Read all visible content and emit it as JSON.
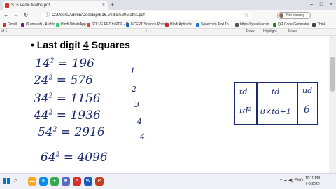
{
  "browser": {
    "tab_title": "S16.Vedic Maths.pdf",
    "tab_close": "×",
    "new_tab": "+",
    "window_controls": [
      "–",
      "□",
      "×"
    ],
    "address": "C:/Users/Admin/Desktop/S16.Vedic%20Maths.pdf",
    "address_info_label": "File",
    "profile_label": "Not syncing",
    "menu": "⋯"
  },
  "bookmarks": [
    {
      "label": "Gmail",
      "color": "#d93025"
    },
    {
      "label": "(9 unread) - Arabic...",
      "color": "#6a1b9a"
    },
    {
      "label": "Hindi WhatsApp",
      "color": "#25d366"
    },
    {
      "label": "SOLVE PPT to PDF - P...",
      "color": "#e64a19"
    },
    {
      "label": "NCERT Science Portal",
      "color": "#1565c0"
    },
    {
      "label": "Hindi Aptitude",
      "color": "#c62828"
    },
    {
      "label": "Speech to Text To...",
      "color": "#1976d2"
    },
    {
      "label": "https://greatlearnin...",
      "color": "#555555"
    },
    {
      "label": "QR Code Generator...",
      "color": "#2e7d32"
    },
    {
      "label": "Think",
      "color": "#444444"
    }
  ],
  "pdf_toolbar": {
    "page": "of 1",
    "zoom_out": "−",
    "zoom_in": "+",
    "draw": "Draw",
    "highlight": "Highlight",
    "erase": "Erase"
  },
  "document": {
    "bullet": "•",
    "heading_prefix": "Last digit",
    "heading_number": "4",
    "heading_suffix": "Squares",
    "equations": [
      {
        "base": "14",
        "result": "196"
      },
      {
        "base": "24",
        "result": "576"
      },
      {
        "base": "34",
        "result": "1156"
      },
      {
        "base": "44",
        "result": "1936"
      },
      {
        "base": "54",
        "result": "2916"
      },
      {
        "base": "64",
        "result": "4096"
      }
    ],
    "exponent": "2",
    "equals": "=",
    "side_digits": [
      "1",
      "2",
      "3",
      "4",
      "4"
    ],
    "box": {
      "top_left": "td",
      "top_mid": "td.",
      "top_right": "ud",
      "bottom_left": "td²",
      "bottom_mid": "8×td+1",
      "bottom_right": "6"
    }
  },
  "taskbar": {
    "search_icon": "⌕",
    "apps": [
      {
        "name": "file-explorer",
        "color": "#f9a825",
        "glyph": "▬"
      },
      {
        "name": "edge",
        "color": "#0c8ce9",
        "glyph": "e"
      },
      {
        "name": "chrome",
        "color": "#34a853",
        "glyph": "●"
      },
      {
        "name": "store",
        "color": "#5c6bc0",
        "glyph": "■"
      },
      {
        "name": "pdf",
        "color": "#d32f2f",
        "glyph": "A"
      },
      {
        "name": "word",
        "color": "#1e5bb8",
        "glyph": "W"
      },
      {
        "name": "powerpoint",
        "color": "#c43e1c",
        "glyph": "P"
      }
    ],
    "tray": "^ ☁ ◀) ENG",
    "time": "10:11 PM",
    "date": "7-6-2020"
  }
}
